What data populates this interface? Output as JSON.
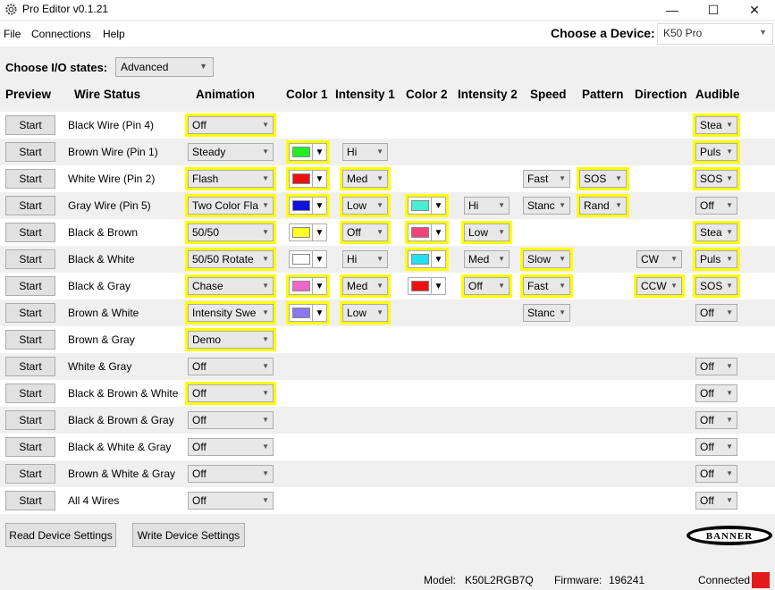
{
  "window": {
    "title": "Pro Editor v0.1.21",
    "minimize": "—",
    "maximize": "☐",
    "close": "✕"
  },
  "menu": {
    "items": [
      "File",
      "Connections",
      "Help"
    ]
  },
  "device": {
    "label": "Choose a Device:",
    "value": "K50 Pro"
  },
  "io_states": {
    "label": "Choose I/O states:",
    "value": "Advanced"
  },
  "headers": {
    "preview": "Preview",
    "wire_status": "Wire Status",
    "animation": "Animation",
    "color1": "Color 1",
    "intensity1": "Intensity 1",
    "color2": "Color 2",
    "intensity2": "Intensity 2",
    "speed": "Speed",
    "pattern": "Pattern",
    "direction": "Direction",
    "audible": "Audible"
  },
  "start_label": "Start",
  "rows": [
    {
      "wire": "Black Wire (Pin 4)",
      "animation": {
        "value": "Off",
        "hl": true
      },
      "audible": {
        "value": "Stea",
        "hl": true
      }
    },
    {
      "wire": "Brown Wire (Pin 1)",
      "animation": {
        "value": "Steady",
        "hl": false
      },
      "color1": {
        "color": "#22ee22",
        "hl": true
      },
      "intensity1": {
        "value": "Hi",
        "hl": false
      },
      "audible": {
        "value": "Puls",
        "hl": true
      }
    },
    {
      "wire": "White Wire (Pin 2)",
      "animation": {
        "value": "Flash",
        "hl": true
      },
      "color1": {
        "color": "#ee1111",
        "hl": true
      },
      "intensity1": {
        "value": "Med",
        "hl": true
      },
      "speed": {
        "value": "Fast",
        "hl": false
      },
      "pattern": {
        "value": "SOS",
        "hl": true
      },
      "audible": {
        "value": "SOS",
        "hl": true
      }
    },
    {
      "wire": "Gray Wire (Pin 5)",
      "animation": {
        "value": "Two Color Fla",
        "hl": true
      },
      "color1": {
        "color": "#1111dd",
        "hl": true
      },
      "intensity1": {
        "value": "Low",
        "hl": true
      },
      "color2": {
        "color": "#44f0d0",
        "hl": true
      },
      "intensity2": {
        "value": "Hi",
        "hl": false
      },
      "speed": {
        "value": "Stanc",
        "hl": false
      },
      "pattern": {
        "value": "Rand",
        "hl": true
      },
      "audible": {
        "value": "Off",
        "hl": false
      }
    },
    {
      "wire": "Black & Brown",
      "animation": {
        "value": "50/50",
        "hl": true
      },
      "color1": {
        "color": "#ffff22",
        "hl": false
      },
      "intensity1": {
        "value": "Off",
        "hl": true
      },
      "color2": {
        "color": "#ee4477",
        "hl": true
      },
      "intensity2": {
        "value": "Low",
        "hl": true
      },
      "audible": {
        "value": "Stea",
        "hl": true
      }
    },
    {
      "wire": "Black & White",
      "animation": {
        "value": "50/50 Rotate",
        "hl": true
      },
      "color1": {
        "color": "#ffffff",
        "hl": false
      },
      "intensity1": {
        "value": "Hi",
        "hl": false
      },
      "color2": {
        "color": "#22e0f0",
        "hl": true
      },
      "intensity2": {
        "value": "Med",
        "hl": false
      },
      "speed": {
        "value": "Slow",
        "hl": true
      },
      "direction": {
        "value": "CW",
        "hl": false
      },
      "audible": {
        "value": "Puls",
        "hl": true
      }
    },
    {
      "wire": "Black & Gray",
      "animation": {
        "value": "Chase",
        "hl": true
      },
      "color1": {
        "color": "#ee66cc",
        "hl": true
      },
      "intensity1": {
        "value": "Med",
        "hl": true
      },
      "color2": {
        "color": "#ee1111",
        "hl": false
      },
      "intensity2": {
        "value": "Off",
        "hl": true
      },
      "speed": {
        "value": "Fast",
        "hl": true
      },
      "direction": {
        "value": "CCW",
        "hl": true
      },
      "audible": {
        "value": "SOS",
        "hl": true
      }
    },
    {
      "wire": "Brown & White",
      "animation": {
        "value": "Intensity Swe",
        "hl": true
      },
      "color1": {
        "color": "#8877ee",
        "hl": true
      },
      "intensity1": {
        "value": "Low",
        "hl": true
      },
      "speed": {
        "value": "Stanc",
        "hl": false
      },
      "audible": {
        "value": "Off",
        "hl": false
      }
    },
    {
      "wire": "Brown & Gray",
      "animation": {
        "value": "Demo",
        "hl": true
      }
    },
    {
      "wire": "White & Gray",
      "animation": {
        "value": "Off",
        "hl": false
      },
      "audible": {
        "value": "Off",
        "hl": false
      }
    },
    {
      "wire": "Black & Brown & White",
      "animation": {
        "value": "Off",
        "hl": true
      },
      "audible": {
        "value": "Off",
        "hl": false
      }
    },
    {
      "wire": "Black & Brown & Gray",
      "animation": {
        "value": "Off",
        "hl": false
      },
      "audible": {
        "value": "Off",
        "hl": false
      }
    },
    {
      "wire": "Black & White & Gray",
      "animation": {
        "value": "Off",
        "hl": false
      },
      "audible": {
        "value": "Off",
        "hl": false
      }
    },
    {
      "wire": "Brown & White & Gray",
      "animation": {
        "value": "Off",
        "hl": false
      },
      "audible": {
        "value": "Off",
        "hl": false
      }
    },
    {
      "wire": "All 4 Wires",
      "animation": {
        "value": "Off",
        "hl": false
      },
      "audible": {
        "value": "Off",
        "hl": false
      }
    }
  ],
  "buttons": {
    "read": "Read Device Settings",
    "write": "Write Device Settings"
  },
  "logo": {
    "text": "BANNER"
  },
  "status_bar": {
    "model_label": "Model:",
    "model_value": "K50L2RGB7Q",
    "firmware_label": "Firmware:",
    "firmware_value": "196241",
    "connected_label": "Connected",
    "connected_color": "#e41a1a"
  },
  "colors": {
    "highlight": "#ffff00"
  }
}
